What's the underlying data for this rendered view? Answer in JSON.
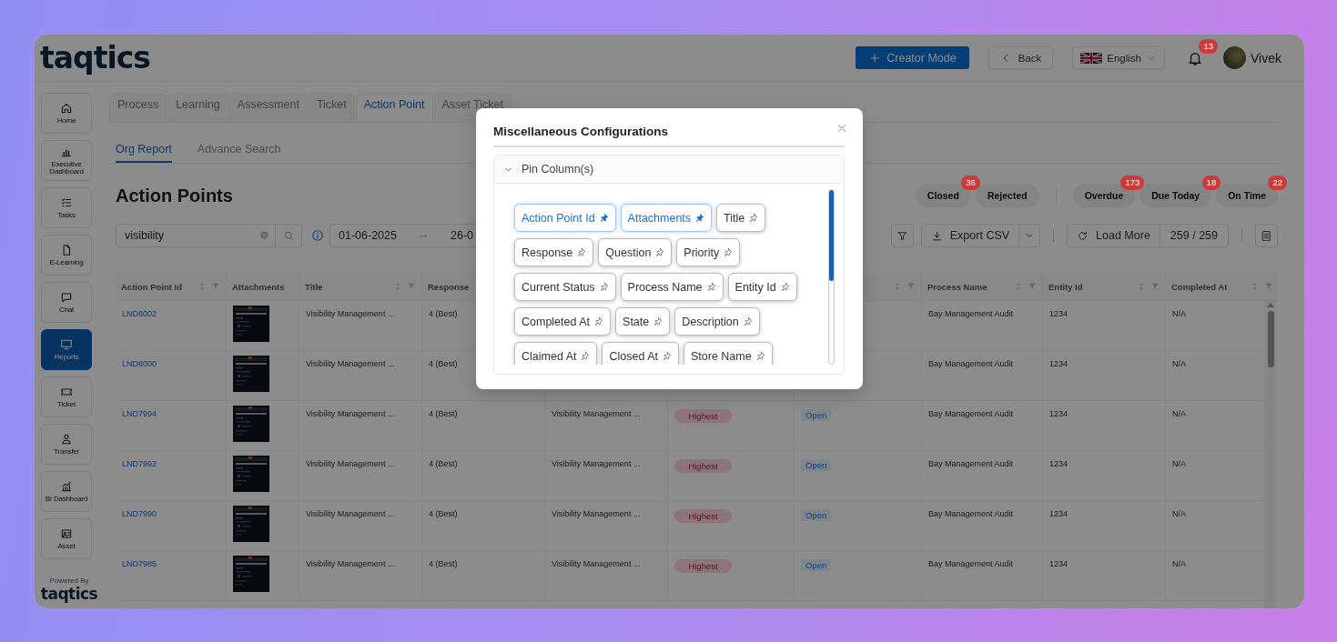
{
  "header": {
    "logo": "taqtics",
    "creator_button": "Creator Mode",
    "back_button": "Back",
    "language": "English",
    "notification_count": "13",
    "user_name": "Vivek"
  },
  "sidebar": {
    "items": [
      {
        "label": "Home",
        "selected": false
      },
      {
        "label": "Executive Dashboard",
        "selected": false
      },
      {
        "label": "Tasks",
        "selected": false
      },
      {
        "label": "E-Learning",
        "selected": false
      },
      {
        "label": "Chat",
        "selected": false
      },
      {
        "label": "Reports",
        "selected": true
      },
      {
        "label": "Ticket",
        "selected": false
      },
      {
        "label": "Transfer",
        "selected": false
      },
      {
        "label": "BI Dashboard",
        "selected": false
      },
      {
        "label": "Asset",
        "selected": false
      }
    ],
    "powered_by": "Powered By",
    "footer_logo": "taqtics"
  },
  "module_tabs": [
    {
      "label": "Process",
      "selected": false
    },
    {
      "label": "Learning",
      "selected": false
    },
    {
      "label": "Assessment",
      "selected": false
    },
    {
      "label": "Ticket",
      "selected": false
    },
    {
      "label": "Action Point",
      "selected": true
    },
    {
      "label": "Asset Ticket",
      "selected": false
    }
  ],
  "sub_tabs": [
    {
      "label": "Org Report",
      "selected": true
    },
    {
      "label": "Advance Search",
      "selected": false
    }
  ],
  "page_title": "Action Points",
  "status_filters": [
    {
      "label": "Closed",
      "count": "36"
    },
    {
      "label": "Rejected"
    }
  ],
  "timing_filters": [
    {
      "label": "Overdue",
      "count": "173"
    },
    {
      "label": "Due Today",
      "count": "18"
    },
    {
      "label": "On Time",
      "count": "22"
    }
  ],
  "search": {
    "value": "visibility"
  },
  "date_range": {
    "start": "01-06-2025",
    "end": "26-0"
  },
  "toolbar": {
    "export_button": "Export CSV",
    "load_more_button": "Load More",
    "record_count": "259 / 259"
  },
  "table": {
    "columns": [
      {
        "kind": "header",
        "label": "Action Point Id",
        "sortable": true,
        "filterable": true
      },
      {
        "kind": "header",
        "label": "Attachments",
        "sortable": false,
        "filterable": false
      },
      {
        "kind": "header",
        "label": "Title",
        "sortable": true,
        "filterable": true
      },
      {
        "kind": "header",
        "label": "Response"
      },
      {
        "kind": "blank"
      },
      {
        "kind": "blank"
      },
      {
        "kind": "header",
        "sortable": true,
        "filterable": true
      },
      {
        "kind": "header",
        "label": "Process Name",
        "sortable": true,
        "filterable": true
      },
      {
        "kind": "header",
        "label": "Entity Id",
        "sortable": true,
        "filterable": true
      },
      {
        "kind": "header",
        "label": "Completed At",
        "sortable": true,
        "filterable": true
      }
    ],
    "rows": [
      {
        "id": "LND8002",
        "title": "Visibility Management ...",
        "response": "4 (Best)",
        "process_name": "Bay Management Audit",
        "entity_id": "1234",
        "completed_at": "N/A"
      },
      {
        "id": "LND8000",
        "title": "Visibility Management ...",
        "response": "4 (Best)",
        "process_name": "Bay Management Audit",
        "entity_id": "1234",
        "completed_at": "N/A"
      },
      {
        "id": "LND7994",
        "title": "Visibility Management ...",
        "response": "4 (Best)",
        "question": "Visibility Management ...",
        "priority": "Highest",
        "status": "Open",
        "process_name": "Bay Management Audit",
        "entity_id": "1234",
        "completed_at": "N/A"
      },
      {
        "id": "LND7992",
        "title": "Visibility Management ...",
        "response": "4 (Best)",
        "question": "Visibility Management ...",
        "priority": "Highest",
        "status": "Open",
        "process_name": "Bay Management Audit",
        "entity_id": "1234",
        "completed_at": "N/A"
      },
      {
        "id": "LND7990",
        "title": "Visibility Management ...",
        "response": "4 (Best)",
        "question": "Visibility Management ...",
        "priority": "Highest",
        "status": "Open",
        "process_name": "Bay Management Audit",
        "entity_id": "1234",
        "completed_at": "N/A"
      },
      {
        "id": "LND7985",
        "title": "Visibility Management ...",
        "response": "4 (Best)",
        "question": "Visibility Management ...",
        "priority": "Highest",
        "status": "Open",
        "process_name": "Bay Management Audit",
        "entity_id": "1234",
        "completed_at": "N/A"
      }
    ]
  },
  "modal": {
    "title": "Miscellaneous Configurations",
    "panel": {
      "title": "Pin Column(s)",
      "expanded": true,
      "pin_columns": [
        {
          "label": "Action Point Id",
          "pinned": true
        },
        {
          "label": "Attachments",
          "pinned": true
        },
        {
          "label": "Title",
          "pinned": false
        },
        {
          "label": "Response",
          "pinned": false
        },
        {
          "label": "Question",
          "pinned": false
        },
        {
          "label": "Priority",
          "pinned": false
        },
        {
          "label": "Current Status",
          "pinned": false
        },
        {
          "label": "Process Name",
          "pinned": false
        },
        {
          "label": "Entity Id",
          "pinned": false
        },
        {
          "label": "Completed At",
          "pinned": false
        },
        {
          "label": "State",
          "pinned": false
        },
        {
          "label": "Description",
          "pinned": false
        },
        {
          "label": "Claimed At",
          "pinned": false
        },
        {
          "label": "Closed At",
          "pinned": false
        },
        {
          "label": "Store Name",
          "pinned": false
        }
      ]
    }
  }
}
